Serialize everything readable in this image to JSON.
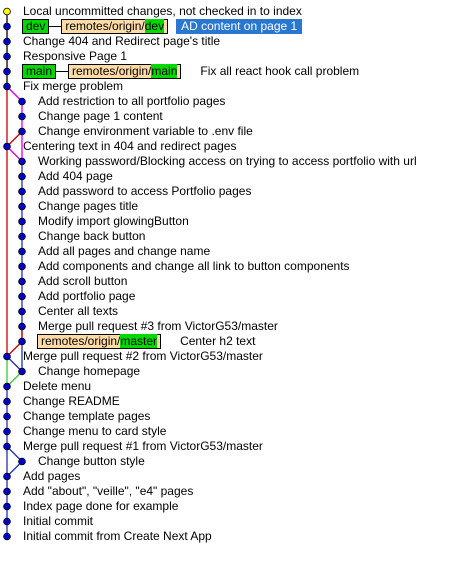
{
  "colors": {
    "node": "#0000cc",
    "uncommitted": "#ffff00",
    "branch_red": "#cc0000",
    "branch_green": "#33cc33",
    "branch_magenta": "#dd00dd",
    "branch_blue": "#2233aa",
    "local_ref": "#00d800",
    "remote_ref": "#ffdba8",
    "selected_ref": "#2a77d0"
  },
  "commits": [
    {
      "message": "Local uncommitted changes, not checked in to index",
      "lane": 0,
      "type": "uncommitted"
    },
    {
      "message": "AD content on page 1",
      "lane": 0,
      "refs": [
        {
          "kind": "local",
          "label": "dev"
        },
        {
          "kind": "remote",
          "prefix": "remotes/origin/",
          "branch": "dev"
        }
      ],
      "selected": true
    },
    {
      "message": "Change 404 and Redirect page's title",
      "lane": 0
    },
    {
      "message": "Responsive Page 1",
      "lane": 0
    },
    {
      "message": "Fix all react hook call problem",
      "lane": 0,
      "refs": [
        {
          "kind": "local",
          "label": "main"
        },
        {
          "kind": "remote",
          "prefix": "remotes/origin/",
          "branch": "main"
        }
      ]
    },
    {
      "message": "Fix merge problem",
      "lane": 0
    },
    {
      "message": "Add restriction to all portfolio pages",
      "lane": 1
    },
    {
      "message": "Change page 1 content",
      "lane": 1
    },
    {
      "message": "Change environment variable to .env file",
      "lane": 1
    },
    {
      "message": "Centering text in 404 and redirect pages",
      "lane": 0
    },
    {
      "message": "Working password/Blocking access on trying to access portfolio with url",
      "lane": 1
    },
    {
      "message": "Add 404 page",
      "lane": 1
    },
    {
      "message": "Add password to access Portfolio pages",
      "lane": 1
    },
    {
      "message": "Change pages title",
      "lane": 1
    },
    {
      "message": "Modify import glowingButton",
      "lane": 1
    },
    {
      "message": "Change back button",
      "lane": 1
    },
    {
      "message": "Add all pages and change name",
      "lane": 1
    },
    {
      "message": "Add components and change all link to button components",
      "lane": 1
    },
    {
      "message": "Add scroll button",
      "lane": 1
    },
    {
      "message": "Add portfolio page",
      "lane": 1
    },
    {
      "message": "Center all texts",
      "lane": 1
    },
    {
      "message": "Merge pull request #3 from VictorG53/master",
      "lane": 1
    },
    {
      "message": "Center h2 text",
      "lane": 1,
      "refs": [
        {
          "kind": "remote",
          "prefix": "remotes/origin/",
          "branch": "master"
        }
      ]
    },
    {
      "message": "Merge pull request #2 from VictorG53/master",
      "lane": 0
    },
    {
      "message": "Change homepage",
      "lane": 1
    },
    {
      "message": "Delete menu",
      "lane": 0
    },
    {
      "message": "Change README",
      "lane": 0
    },
    {
      "message": "Change template pages",
      "lane": 0
    },
    {
      "message": "Change menu to card style",
      "lane": 0
    },
    {
      "message": "Merge pull request #1 from VictorG53/master",
      "lane": 0
    },
    {
      "message": "Change button style",
      "lane": 1
    },
    {
      "message": "Add pages",
      "lane": 0
    },
    {
      "message": "Add \"about\", \"veille\", \"e4\" pages",
      "lane": 0
    },
    {
      "message": "Index page done for example",
      "lane": 0
    },
    {
      "message": "Initial commit",
      "lane": 0
    },
    {
      "message": "Initial commit from Create Next App",
      "lane": 0
    }
  ]
}
